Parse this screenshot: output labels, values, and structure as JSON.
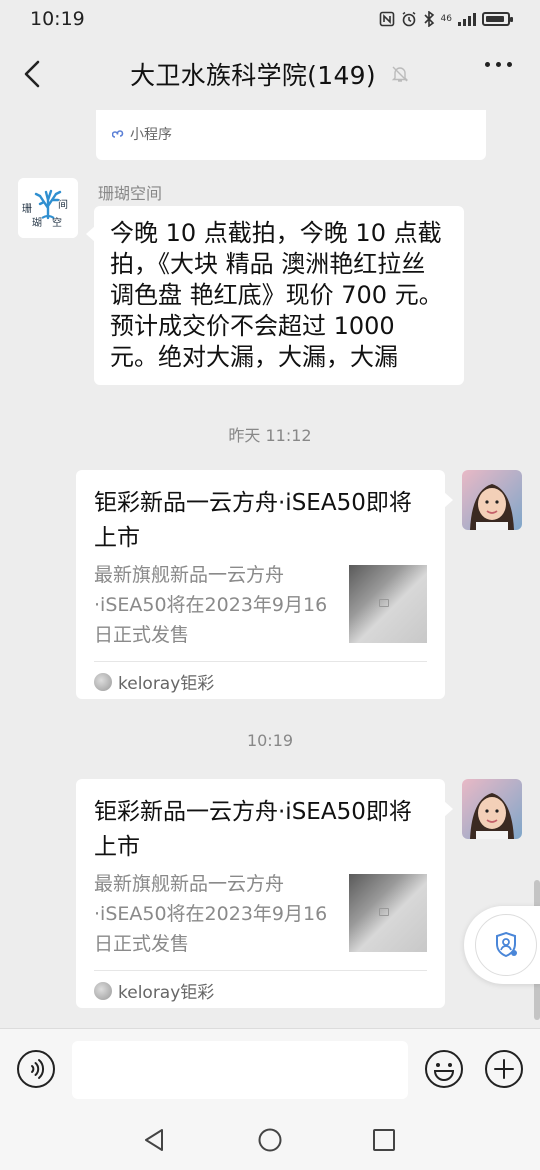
{
  "status_bar": {
    "time": "10:19",
    "network": "46"
  },
  "header": {
    "title": "大卫水族科学院(149)"
  },
  "chat": {
    "previous_card": {
      "source_label": "小程序"
    },
    "message_1": {
      "sender": "珊瑚空间",
      "avatar_text": [
        "珊",
        "瑚",
        "间",
        "空"
      ],
      "text": "今晚 10 点截拍，今晚 10 点截拍，《大块 精品 澳洲艳红拉丝 调色盘 艳红底》现价 700 元。预计成交价不会超过 1000 元。绝对大漏，大漏，大漏"
    },
    "timestamp_1": "昨天 11:12",
    "card_1": {
      "title": "钜彩新品一云方舟·iSEA50即将上市",
      "description": "最新旗舰新品一云方舟·iSEA50将在2023年9月16日正式发售",
      "source": "keloray钜彩"
    },
    "timestamp_2": "10:19",
    "card_2": {
      "title": "钜彩新品一云方舟·iSEA50即将上市",
      "description": "最新旗舰新品一云方舟·iSEA50将在2023年9月16日正式发售",
      "source": "keloray钜彩"
    }
  },
  "input_bar": {
    "placeholder": ""
  },
  "colors": {
    "background": "#ededed",
    "bubble": "#ffffff",
    "meta_text": "#888888",
    "coral_blue": "#2f8fd0"
  },
  "icons": [
    "back-icon",
    "mute-bell-icon",
    "more-icon",
    "voice-icon",
    "emoji-icon",
    "plus-icon",
    "shield-user-icon",
    "back-triangle-icon",
    "home-circle-icon",
    "recents-square-icon"
  ]
}
